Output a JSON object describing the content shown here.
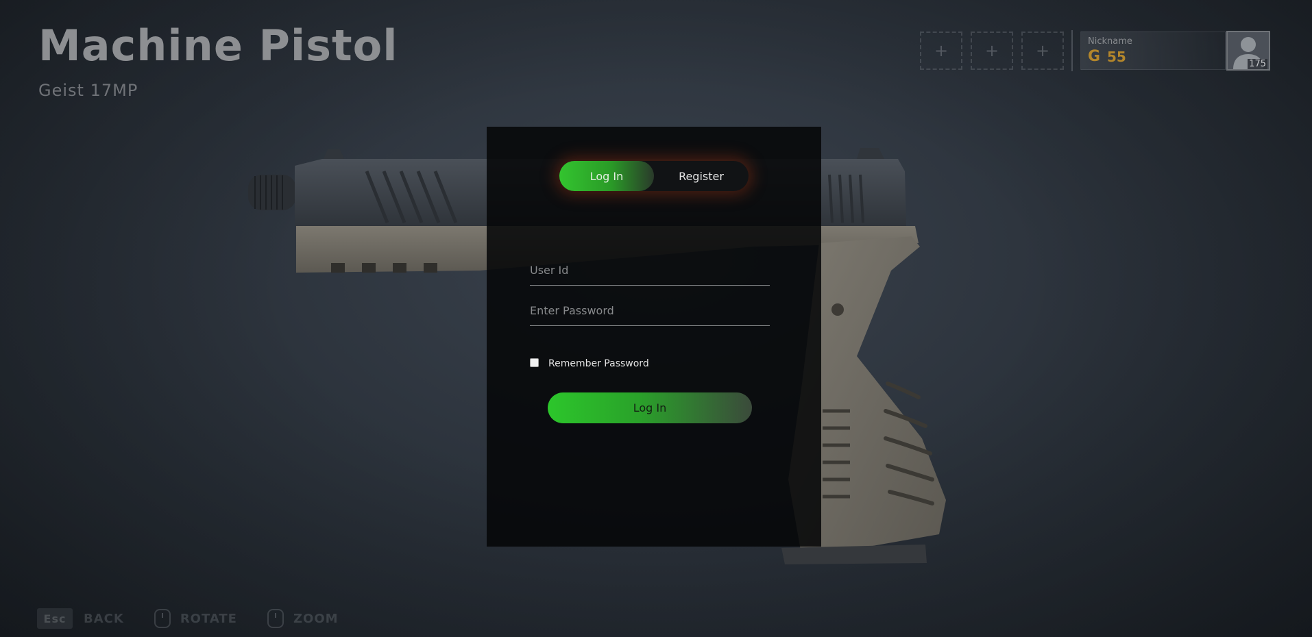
{
  "header": {
    "title": "Machine Pistol",
    "subtitle": "Geist 17MP"
  },
  "top_right": {
    "slots": [
      "+",
      "+",
      "+"
    ],
    "profile": {
      "nickname_label": "Nickname",
      "currency_icon": "G",
      "currency_value": "55",
      "level": "175"
    }
  },
  "login_modal": {
    "tabs": {
      "login": "Log In",
      "register": "Register"
    },
    "fields": {
      "user_id": "User Id",
      "password": "Enter Password"
    },
    "remember_label": "Remember Password",
    "remember_checked": false,
    "submit_label": "Log In"
  },
  "hints": {
    "esc_key": "Esc",
    "back": "BACK",
    "rotate": "ROTATE",
    "zoom": "ZOOM"
  },
  "colors": {
    "accent_green": "#33c42f",
    "currency_gold": "#b3862b",
    "modal_bg": "#050607"
  }
}
